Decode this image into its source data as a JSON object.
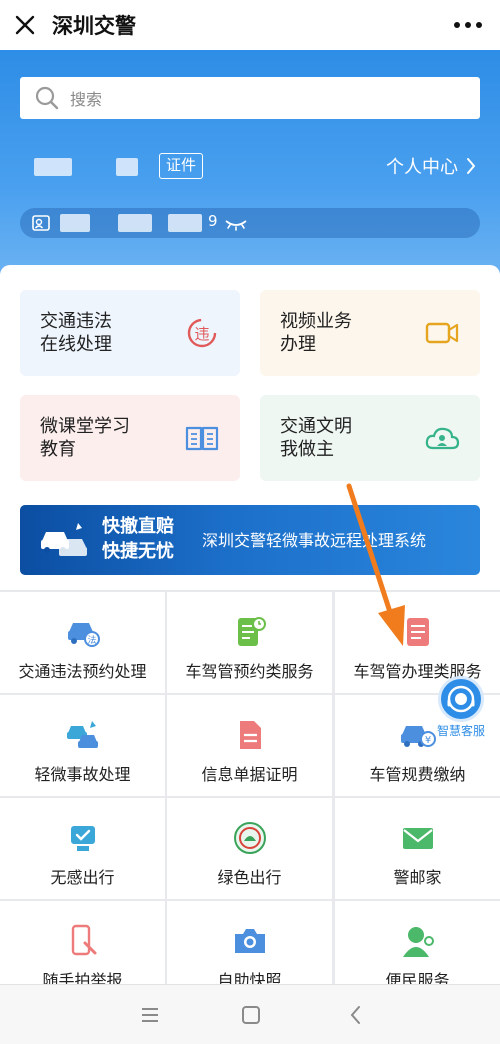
{
  "topbar": {
    "title": "深圳交警"
  },
  "search": {
    "placeholder": "搜索"
  },
  "profile": {
    "id_badge": "证件",
    "personal_center": "个人中心"
  },
  "plate": {
    "visible_char": "9"
  },
  "tiles": [
    {
      "label": "交通违法\n在线处理",
      "icon": "violation-icon",
      "bg": "#eef5fd"
    },
    {
      "label": "视频业务\n办理",
      "icon": "video-camera-icon",
      "bg": "#fdf6ec"
    },
    {
      "label": "微课堂学习\n教育",
      "icon": "open-book-icon",
      "bg": "#fdeeee"
    },
    {
      "label": "交通文明\n我做主",
      "icon": "cloud-user-icon",
      "bg": "#eef7f1"
    }
  ],
  "banner": {
    "main": "快撤直赔\n快捷无忧",
    "sub": "深圳交警轻微事故远程处理系统"
  },
  "grid": [
    {
      "label": "交通违法预约处理",
      "icon": "car-violation-icon"
    },
    {
      "label": "车驾管预约类服务",
      "icon": "appointment-doc-icon"
    },
    {
      "label": "车驾管办理类服务",
      "icon": "document-icon"
    },
    {
      "label": "轻微事故处理",
      "icon": "car-accident-icon"
    },
    {
      "label": "信息单据证明",
      "icon": "certificate-icon"
    },
    {
      "label": "车管规费缴纳",
      "icon": "car-fee-icon"
    },
    {
      "label": "无感出行",
      "icon": "contactless-icon"
    },
    {
      "label": "绿色出行",
      "icon": "green-travel-icon"
    },
    {
      "label": "警邮家",
      "icon": "mail-icon"
    },
    {
      "label": "随手拍举报",
      "icon": "phone-report-icon"
    },
    {
      "label": "自助快照",
      "icon": "camera-icon"
    },
    {
      "label": "便民服务",
      "icon": "customer-service-icon"
    }
  ],
  "service_fab": {
    "label": "智慧客服"
  },
  "colors": {
    "primary": "#2e8de6",
    "arrow": "#f07c1e"
  }
}
